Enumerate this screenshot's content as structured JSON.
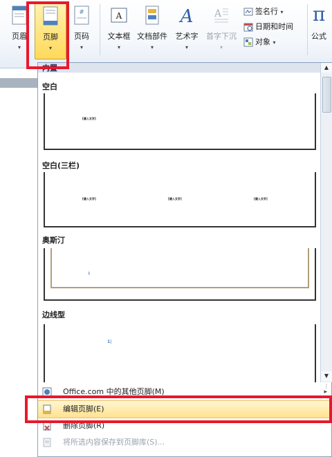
{
  "ribbon": {
    "header": "页眉",
    "footer": "页脚",
    "page_number": "页码",
    "textbox": "文本框",
    "quickparts": "文档部件",
    "wordart": "艺术字",
    "dropcap": "首字下沉",
    "signature": "签名行",
    "datetime": "日期和时间",
    "object": "对象",
    "equation": "公式",
    "dropdown_glyph": "▾"
  },
  "gallery": {
    "section_header": "内置",
    "items": [
      {
        "title": "空白",
        "placeholder": "[键入文字]"
      },
      {
        "title": "空白(三栏)",
        "placeholders": [
          "[键入文字]",
          "[键入文字]",
          "[键入文字]"
        ]
      },
      {
        "title": "奥斯汀",
        "page_mark": "1"
      },
      {
        "title": "边线型",
        "page_mark": "1|"
      }
    ]
  },
  "scroll": {
    "up": "▲",
    "down": "▼",
    "grip": "⋮"
  },
  "menu": {
    "more_online": "Office.com 中的其他页脚(M)",
    "edit_footer": "编辑页脚(E)",
    "remove_footer": "删除页脚(R)",
    "save_selection": "将所选内容保存到页脚库(S)...",
    "submenu_arrow": "▸"
  },
  "colors": {
    "highlight_box": "#e8182c",
    "hover_fill": "#ffe28d",
    "accent": "#23355a"
  }
}
